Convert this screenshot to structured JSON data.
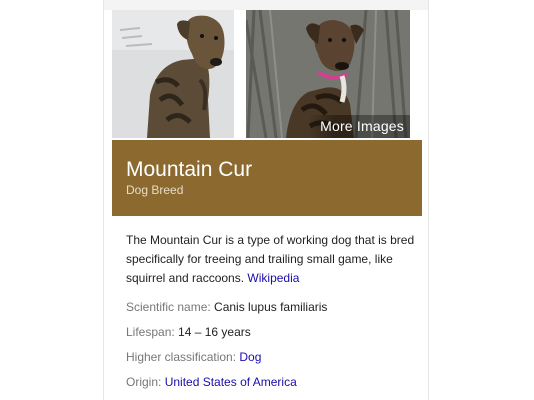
{
  "images": {
    "more_images_label": "More Images"
  },
  "entity": {
    "title": "Mountain Cur",
    "subtitle": "Dog Breed",
    "description": "The Mountain Cur is a type of working dog that is bred specifically for treeing and trailing small game, like squirrel and raccoons.",
    "source_link": "Wikipedia",
    "band_color": "#8c6a2f",
    "link_color": "#1a0dab"
  },
  "facts": [
    {
      "label": "Scientific name:",
      "value": "Canis lupus familiaris",
      "is_link": false
    },
    {
      "label": "Lifespan:",
      "value": "14 – 16 years",
      "is_link": false
    },
    {
      "label": "Higher classification:",
      "value": "Dog",
      "is_link": true
    },
    {
      "label": "Origin:",
      "value": "United States of America",
      "is_link": true
    }
  ]
}
